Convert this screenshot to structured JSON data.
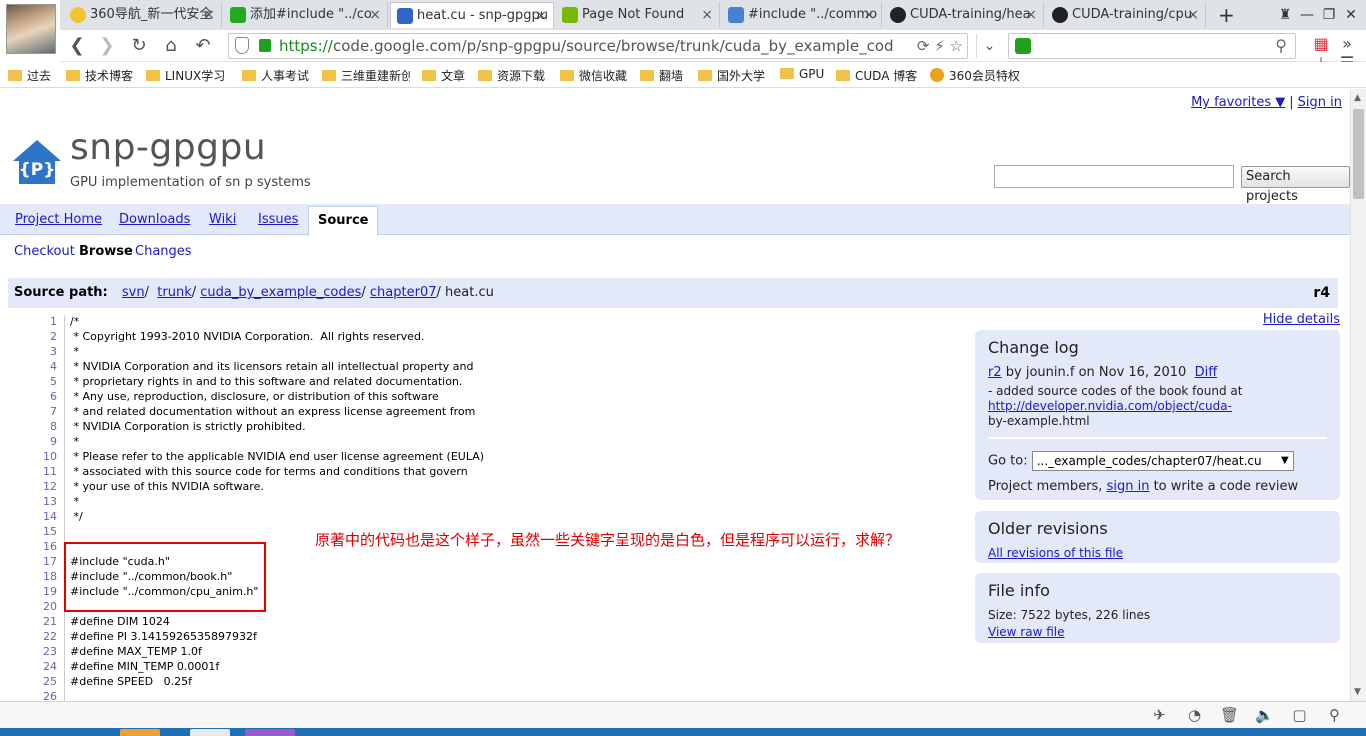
{
  "browser": {
    "tabs": [
      {
        "label": "360导航_新一代安全",
        "icon_color": "#f4c430"
      },
      {
        "label": "添加#include \"../co",
        "icon_color": "#22aa22"
      },
      {
        "label": "heat.cu - snp-gpgpu",
        "icon_color": "#3366cc"
      },
      {
        "label": "Page Not Found",
        "icon_color": "#76b900"
      },
      {
        "label": "#include \"../commo",
        "icon_color": "#4a7fd6"
      },
      {
        "label": "CUDA-training/hea",
        "icon_color": "#222222"
      },
      {
        "label": "CUDA-training/cpu",
        "icon_color": "#222222"
      }
    ],
    "new_tab_icon": "+",
    "window_controls": [
      "shirt-icon",
      "minimize-icon",
      "maximize-icon",
      "close-icon"
    ],
    "address": {
      "scheme": "https://",
      "url_rest": "code.google.com/p/snp-gpgpu/source/browse/trunk/cuda_by_example_cod"
    },
    "bookmarks": [
      "过去",
      "技术博客",
      "LINUX学习",
      "人事考试",
      "三维重建新创",
      "文章",
      "资源下载",
      "微信收藏",
      "翻墙",
      "国外大学",
      "GPU",
      "CUDA 博客",
      "360会员特权"
    ]
  },
  "page": {
    "top_links": {
      "favorites": "My favorites ▼",
      "separator": "|",
      "sign_in": "Sign in"
    },
    "logo_text": "{P}",
    "project_name": "snp-gpgpu",
    "project_summary": "GPU implementation of sn p systems",
    "search_button": "Search projects",
    "main_tabs": [
      "Project Home",
      "Downloads",
      "Wiki",
      "Issues",
      "Source"
    ],
    "sub_tabs": [
      "Checkout",
      "Browse",
      "Changes"
    ],
    "source_path": {
      "label": "Source path:",
      "parts": [
        "svn",
        "trunk",
        "cuda_by_example_codes",
        "chapter07"
      ],
      "file": "heat.cu",
      "revision": "r4"
    },
    "code_lines": [
      {
        "n": "1",
        "t": "/*"
      },
      {
        "n": "2",
        "t": " * Copyright 1993-2010 NVIDIA Corporation.  All rights reserved."
      },
      {
        "n": "3",
        "t": " *"
      },
      {
        "n": "4",
        "t": " * NVIDIA Corporation and its licensors retain all intellectual property and"
      },
      {
        "n": "5",
        "t": " * proprietary rights in and to this software and related documentation."
      },
      {
        "n": "6",
        "t": " * Any use, reproduction, disclosure, or distribution of this software"
      },
      {
        "n": "7",
        "t": " * and related documentation without an express license agreement from"
      },
      {
        "n": "8",
        "t": " * NVIDIA Corporation is strictly prohibited."
      },
      {
        "n": "9",
        "t": " *"
      },
      {
        "n": "10",
        "t": " * Please refer to the applicable NVIDIA end user license agreement (EULA)"
      },
      {
        "n": "11",
        "t": " * associated with this source code for terms and conditions that govern"
      },
      {
        "n": "12",
        "t": " * your use of this NVIDIA software."
      },
      {
        "n": "13",
        "t": " *"
      },
      {
        "n": "14",
        "t": " */"
      },
      {
        "n": "15",
        "t": ""
      },
      {
        "n": "16",
        "t": ""
      },
      {
        "n": "17",
        "t": "#include \"cuda.h\""
      },
      {
        "n": "18",
        "t": "#include \"../common/book.h\""
      },
      {
        "n": "19",
        "t": "#include \"../common/cpu_anim.h\""
      },
      {
        "n": "20",
        "t": ""
      },
      {
        "n": "21",
        "t": "#define DIM 1024"
      },
      {
        "n": "22",
        "t": "#define PI 3.1415926535897932f"
      },
      {
        "n": "23",
        "t": "#define MAX_TEMP 1.0f"
      },
      {
        "n": "24",
        "t": "#define MIN_TEMP 0.0001f"
      },
      {
        "n": "25",
        "t": "#define SPEED   0.25f"
      },
      {
        "n": "26",
        "t": ""
      }
    ],
    "annotation": "原著中的代码也是这个样子，虽然一些关键字呈现的是白色，但是程序可以运行，求解？",
    "hide_details": "Hide details",
    "change_log": {
      "title": "Change log",
      "rev": "r2",
      "by": " by jounin.f on Nov 16, 2010 ",
      "diff": "Diff",
      "msg1": "- added source codes of the book found at",
      "link": "http://developer.nvidia.com/object/cuda-",
      "msg2": "by-example.html",
      "goto_label": "Go to:",
      "goto_value": "..._example_codes/chapter07/heat.cu",
      "members_pre": "Project members, ",
      "members_link": "sign in",
      "members_post": " to write a code review"
    },
    "older_revisions": {
      "title": "Older revisions",
      "link": "All revisions of this file"
    },
    "file_info": {
      "title": "File info",
      "size": "Size: 7522 bytes, 226 lines",
      "raw": "View raw file"
    }
  },
  "colors": {
    "accent_blue": "#1a1acc",
    "tab_bg": "#e3e9f8",
    "annotation_red": "#e00000"
  }
}
